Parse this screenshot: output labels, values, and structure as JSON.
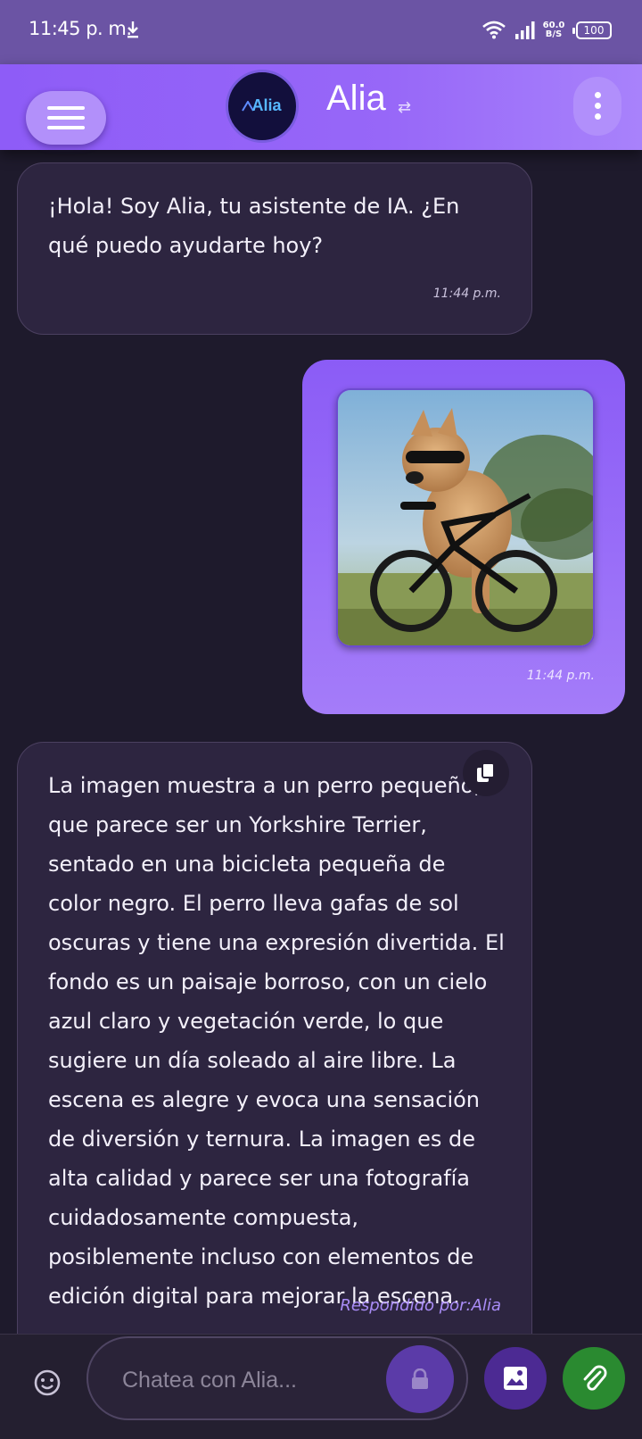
{
  "status_bar": {
    "time": "11:45 p. m.",
    "net_speed_value": "60.0",
    "net_speed_unit": "B/S",
    "battery": "100",
    "icons": [
      "download-icon",
      "wifi-icon",
      "signal-icon",
      "battery-icon"
    ]
  },
  "header": {
    "avatar_text": "Alia",
    "title": "Alia",
    "swap_icon": "⇄",
    "menu_icon": "menu-icon",
    "more_icon": "more-vert-icon"
  },
  "messages": [
    {
      "role": "assistant",
      "text": "¡Hola! Soy Alia, tu asistente de IA. ¿En qué puedo ayudarte hoy?",
      "time": "11:44 p.m."
    },
    {
      "role": "user",
      "image_subject": "dog-on-bicycle-photo",
      "time": "11:44 p.m."
    },
    {
      "role": "assistant",
      "text": "La imagen muestra a un perro pequeño, que parece ser un Yorkshire Terrier, sentado en una bicicleta pequeña de color negro. El perro lleva gafas de sol oscuras y tiene una expresión divertida. El fondo es un paisaje borroso, con un cielo azul claro y vegetación verde, lo que sugiere un día soleado al aire libre. La escena es alegre y evoca una sensación de diversión y ternura. La imagen es de alta calidad y parece ser una fotografía cuidadosamente compuesta, posiblemente incluso con elementos de edición digital para mejorar la escena.",
      "footer": "Respondido por:Alia"
    }
  ],
  "input": {
    "placeholder": "Chatea con Alia...",
    "value": ""
  },
  "colors": {
    "background": "#1e1a2c",
    "header": "#8e5cf7",
    "user_bubble": "#8b5cf6",
    "assistant_bubble": "#2d2540",
    "attach": "#2a8a30"
  }
}
